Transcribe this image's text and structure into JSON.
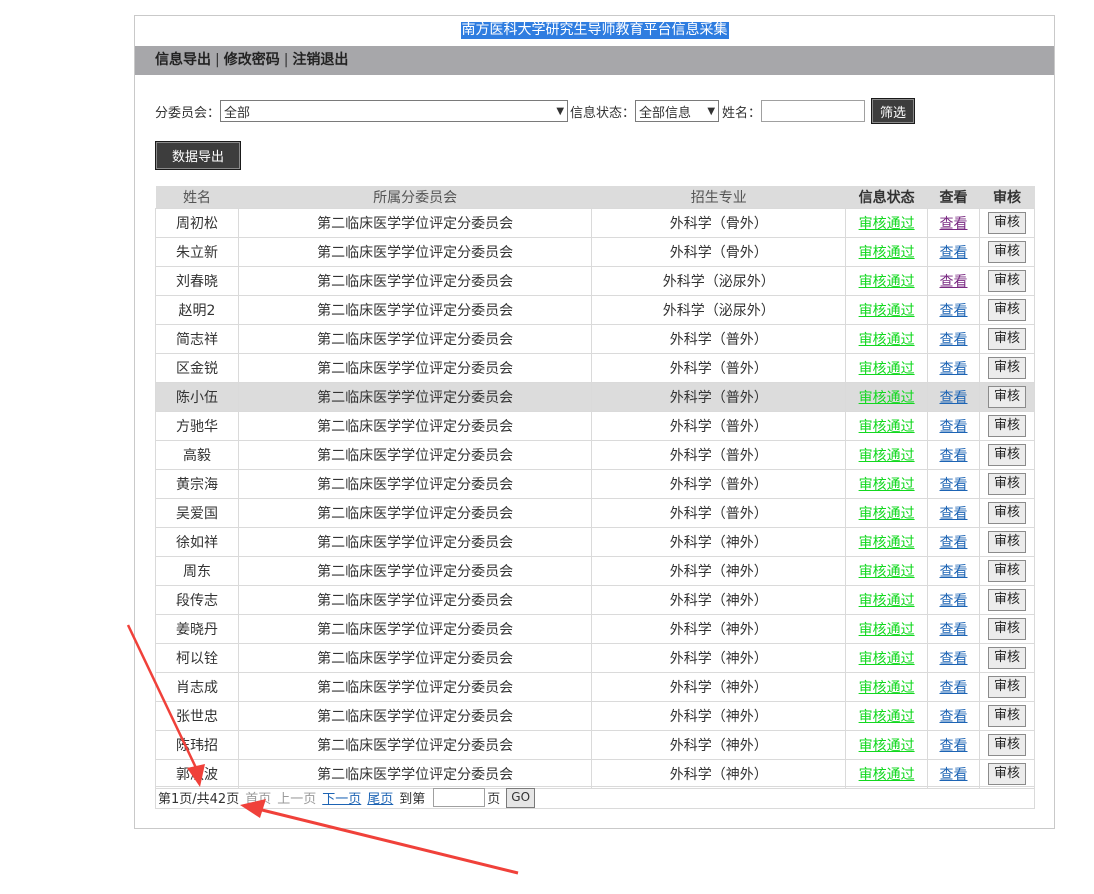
{
  "header": {
    "title": "南方医科大学研究生导师教育平台信息采集"
  },
  "nav": [
    {
      "label": "信息导出"
    },
    {
      "label": "修改密码"
    },
    {
      "label": "注销退出"
    }
  ],
  "nav_separator": "|",
  "filters": {
    "committee_label": "分委员会：",
    "committee_value": "全部",
    "status_label": "信息状态：",
    "status_value": "全部信息",
    "name_label": "姓名：",
    "name_value": "",
    "filter_button": "筛选"
  },
  "export_button": "数据导出",
  "table": {
    "headers": [
      "姓名",
      "所属分委员会",
      "招生专业",
      "信息状态",
      "查看",
      "审核"
    ],
    "view_label": "查看",
    "audit_label": "审核",
    "rows": [
      {
        "name": "周初松",
        "committee": "第二临床医学学位评定分委员会",
        "major": "外科学（骨外）",
        "status": "审核通过"
      },
      {
        "name": "朱立新",
        "committee": "第二临床医学学位评定分委员会",
        "major": "外科学（骨外）",
        "status": "审核通过"
      },
      {
        "name": "刘春晓",
        "committee": "第二临床医学学位评定分委员会",
        "major": "外科学（泌尿外）",
        "status": "审核通过"
      },
      {
        "name": "赵明2",
        "committee": "第二临床医学学位评定分委员会",
        "major": "外科学（泌尿外）",
        "status": "审核通过"
      },
      {
        "name": "简志祥",
        "committee": "第二临床医学学位评定分委员会",
        "major": "外科学（普外）",
        "status": "审核通过"
      },
      {
        "name": "区金锐",
        "committee": "第二临床医学学位评定分委员会",
        "major": "外科学（普外）",
        "status": "审核通过"
      },
      {
        "name": "陈小伍",
        "committee": "第二临床医学学位评定分委员会",
        "major": "外科学（普外）",
        "status": "审核通过"
      },
      {
        "name": "方驰华",
        "committee": "第二临床医学学位评定分委员会",
        "major": "外科学（普外）",
        "status": "审核通过"
      },
      {
        "name": "高毅",
        "committee": "第二临床医学学位评定分委员会",
        "major": "外科学（普外）",
        "status": "审核通过"
      },
      {
        "name": "黄宗海",
        "committee": "第二临床医学学位评定分委员会",
        "major": "外科学（普外）",
        "status": "审核通过"
      },
      {
        "name": "吴爱国",
        "committee": "第二临床医学学位评定分委员会",
        "major": "外科学（普外）",
        "status": "审核通过"
      },
      {
        "name": "徐如祥",
        "committee": "第二临床医学学位评定分委员会",
        "major": "外科学（神外）",
        "status": "审核通过"
      },
      {
        "name": "周东",
        "committee": "第二临床医学学位评定分委员会",
        "major": "外科学（神外）",
        "status": "审核通过"
      },
      {
        "name": "段传志",
        "committee": "第二临床医学学位评定分委员会",
        "major": "外科学（神外）",
        "status": "审核通过"
      },
      {
        "name": "姜晓丹",
        "committee": "第二临床医学学位评定分委员会",
        "major": "外科学（神外）",
        "status": "审核通过"
      },
      {
        "name": "柯以铨",
        "committee": "第二临床医学学位评定分委员会",
        "major": "外科学（神外）",
        "status": "审核通过"
      },
      {
        "name": "肖志成",
        "committee": "第二临床医学学位评定分委员会",
        "major": "外科学（神外）",
        "status": "审核通过"
      },
      {
        "name": "张世忠",
        "committee": "第二临床医学学位评定分委员会",
        "major": "外科学（神外）",
        "status": "审核通过"
      },
      {
        "name": "陈玮招",
        "committee": "第二临床医学学位评定分委员会",
        "major": "外科学（神外）",
        "status": "审核通过"
      },
      {
        "name": "郭淑波",
        "committee": "第二临床医学学位评定分委员会",
        "major": "外科学（神外）",
        "status": "审核通过"
      }
    ]
  },
  "pager": {
    "info": "第1页/共42页",
    "first": "首页",
    "prev": "上一页",
    "next": "下一页",
    "last": "尾页",
    "goto_prefix": "到第",
    "goto_suffix": "页",
    "go_button": "GO"
  },
  "colors": {
    "status_green": "#12d81f",
    "link_blue": "#1d64b4",
    "annotation_red": "#f0413a"
  }
}
